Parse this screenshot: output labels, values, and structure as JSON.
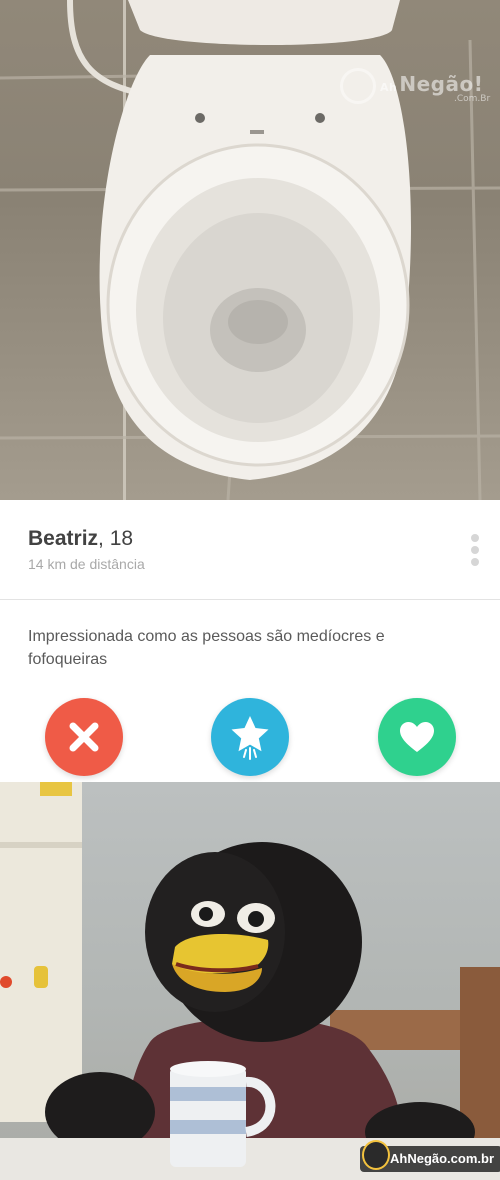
{
  "profile": {
    "name": "Beatriz",
    "age": ", 18",
    "distance": "14 km de distância",
    "bio": "Impressionada como as pessoas são medíocres e fofoqueiras"
  },
  "watermarks": {
    "top_small": "Ah",
    "top_main": "Negão!",
    "top_sub": ".Com.Br",
    "bottom": "AhNegão.com.br"
  },
  "colors": {
    "nope": "#ef5b47",
    "super_like": "#2fb4dc",
    "like": "#2fd18e"
  },
  "icons": {
    "nope": "close-icon",
    "super_like": "star-icon",
    "like": "heart-icon",
    "more": "more-vertical-icon"
  }
}
